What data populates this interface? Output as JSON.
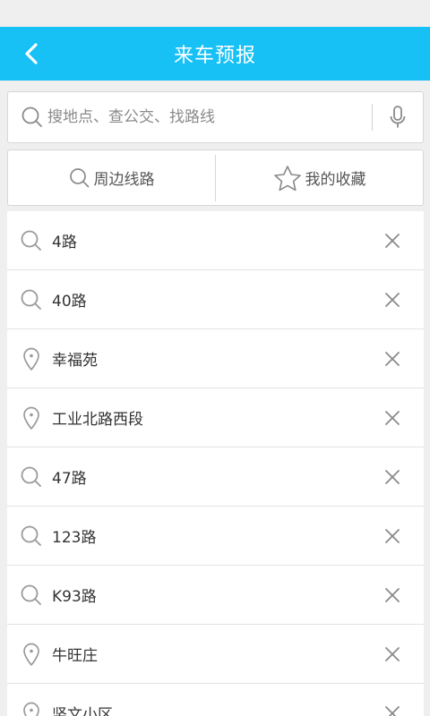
{
  "header": {
    "title": "来车预报"
  },
  "search": {
    "placeholder": "搜地点、查公交、找路线",
    "value": ""
  },
  "actions": {
    "nearby_label": "周边线路",
    "favorites_label": "我的收藏"
  },
  "history": [
    {
      "type": "search",
      "label": "4路"
    },
    {
      "type": "search",
      "label": "40路"
    },
    {
      "type": "location",
      "label": "幸福苑"
    },
    {
      "type": "location",
      "label": "工业北路西段"
    },
    {
      "type": "search",
      "label": "47路"
    },
    {
      "type": "search",
      "label": "123路"
    },
    {
      "type": "search",
      "label": "K93路"
    },
    {
      "type": "location",
      "label": "牛旺庄"
    },
    {
      "type": "location",
      "label": "竖文小区"
    }
  ],
  "colors": {
    "accent": "#17c0f5",
    "icon": "#9a9a9a"
  }
}
